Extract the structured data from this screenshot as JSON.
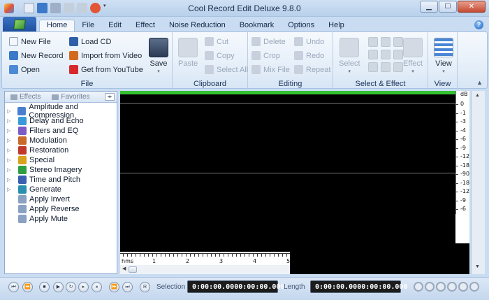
{
  "title": "Cool Record Edit Deluxe 9.8.0",
  "tabs": [
    {
      "label": "Home",
      "active": true
    },
    {
      "label": "File"
    },
    {
      "label": "Edit"
    },
    {
      "label": "Effect"
    },
    {
      "label": "Noise Reduction"
    },
    {
      "label": "Bookmark"
    },
    {
      "label": "Options"
    },
    {
      "label": "Help"
    }
  ],
  "ribbon": {
    "file": {
      "label": "File",
      "new_file": "New File",
      "new_record": "New Record",
      "open": "Open",
      "load_cd": "Load CD",
      "import_video": "Import from Video",
      "get_youtube": "Get from YouTube",
      "save": "Save"
    },
    "clipboard": {
      "label": "Clipboard",
      "paste": "Paste",
      "cut": "Cut",
      "copy": "Copy",
      "select_all": "Select All"
    },
    "editing": {
      "label": "Editing",
      "delete": "Delete",
      "crop": "Crop",
      "mix_file": "Mix File",
      "undo": "Undo",
      "redo": "Redo",
      "repeat": "Repeat"
    },
    "select_effect": {
      "label": "Select & Effect",
      "select": "Select",
      "effect": "Effect"
    },
    "view": {
      "label": "View",
      "view": "View"
    }
  },
  "panel": {
    "tab_effects": "Effects",
    "tab_favorites": "Favorites",
    "nav": "◂▸",
    "items": [
      {
        "label": "Amplitude and Compression",
        "icon": "amplitude-icon",
        "color": "#4a7fd0"
      },
      {
        "label": "Delay and Echo",
        "icon": "echo-icon",
        "color": "#3a9ad8"
      },
      {
        "label": "Filters and EQ",
        "icon": "filter-icon",
        "color": "#7b5cc6"
      },
      {
        "label": "Modulation",
        "icon": "modulation-icon",
        "color": "#c96a2a"
      },
      {
        "label": "Restoration",
        "icon": "restoration-icon",
        "color": "#c03a2b"
      },
      {
        "label": "Special",
        "icon": "special-icon",
        "color": "#d9a21c"
      },
      {
        "label": "Stereo Imagery",
        "icon": "stereo-icon",
        "color": "#2e9e43"
      },
      {
        "label": "Time and Pitch",
        "icon": "time-pitch-icon",
        "color": "#3a5fb0"
      },
      {
        "label": "Generate",
        "icon": "generate-icon",
        "color": "#2a8fb0"
      },
      {
        "label": "Apply Invert",
        "icon": "invert-icon",
        "color": "#8aa2c2",
        "leaf": true
      },
      {
        "label": "Apply Reverse",
        "icon": "reverse-icon",
        "color": "#8aa2c2",
        "leaf": true
      },
      {
        "label": "Apply Mute",
        "icon": "mute-icon",
        "color": "#8aa2c2",
        "leaf": true
      }
    ]
  },
  "db_scale": [
    "dB",
    "0",
    "-1",
    "-3",
    "-4",
    "-6",
    "-9",
    "-12",
    "-18",
    "-90",
    "-18",
    "-12",
    "-9",
    "-6"
  ],
  "ruler": [
    "hms",
    "1",
    "2",
    "3",
    "4",
    "5"
  ],
  "transport": {
    "selection_label": "Selection",
    "selection_start": "0:00:00.000",
    "selection_end": "0:00:00.000",
    "length_label": "Length",
    "length_start": "0:00:00.000",
    "length_end": "0:00:00.000",
    "r_button": "R"
  }
}
